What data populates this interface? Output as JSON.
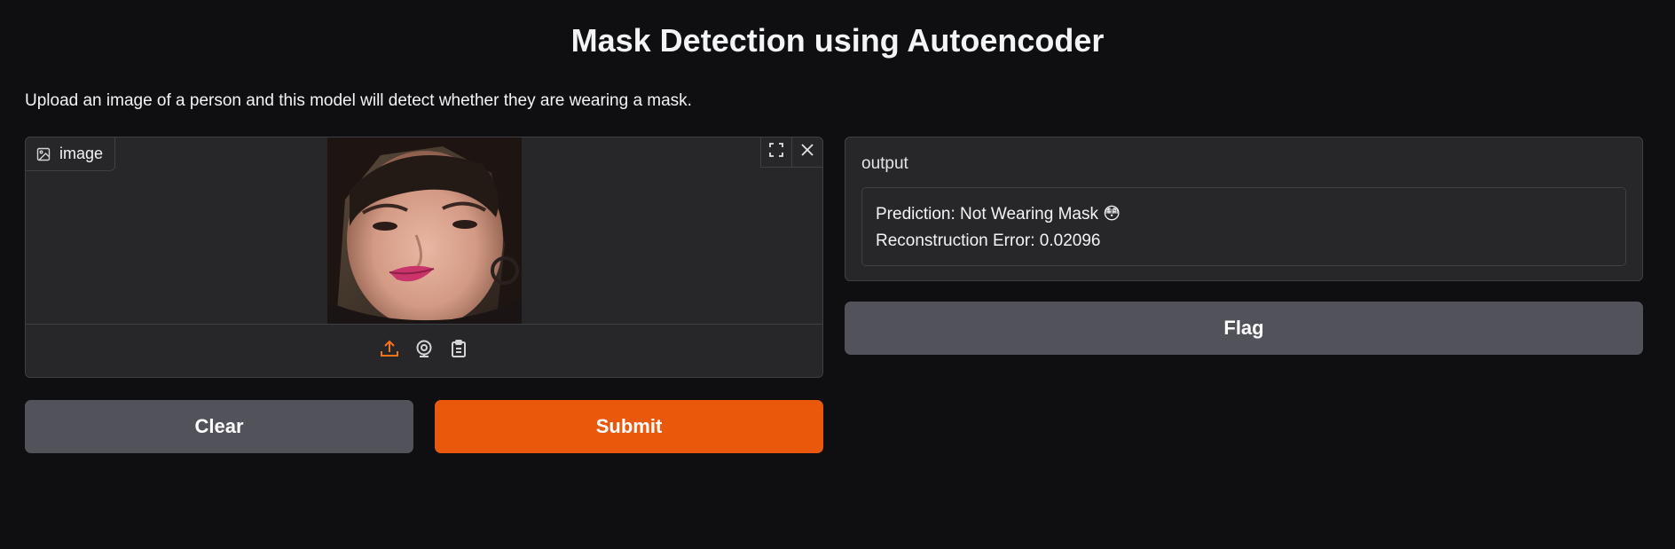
{
  "app": {
    "title": "Mask Detection using Autoencoder",
    "description": "Upload an image of a person and this model will detect whether they are wearing a mask."
  },
  "input": {
    "label": "image",
    "icons": {
      "label_icon": "image-icon",
      "fullscreen": "fullscreen-icon",
      "clear": "close-icon",
      "upload": "upload-icon",
      "webcam": "webcam-icon",
      "clipboard": "clipboard-icon"
    }
  },
  "output": {
    "label": "output",
    "lines": [
      "Prediction: Not Wearing Mask 😳",
      "Reconstruction Error: 0.02096"
    ]
  },
  "buttons": {
    "clear": "Clear",
    "submit": "Submit",
    "flag": "Flag"
  },
  "colors": {
    "background": "#0f0f11",
    "panel": "#27272a",
    "border": "#3f3f46",
    "primary": "#ea580c",
    "secondary": "#52525b",
    "upload_accent": "#f97316"
  }
}
